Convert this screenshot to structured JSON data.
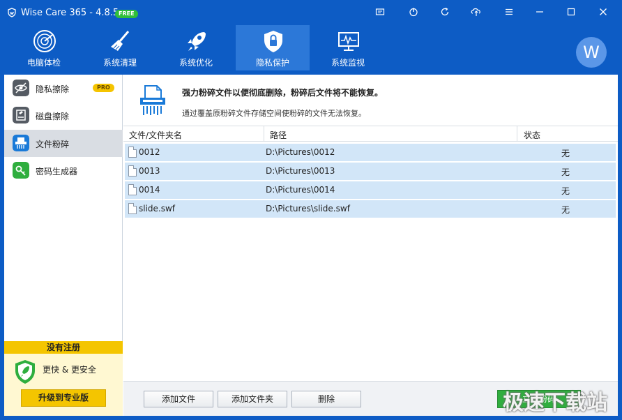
{
  "app": {
    "title": "Wise Care 365 - 4.8.5",
    "badge": "FREE",
    "accent_color": "#0d5cc5",
    "titlebar_icons": [
      "feedback-icon",
      "power-icon",
      "refresh-icon",
      "upload-icon",
      "menu-icon",
      "minimize-icon",
      "maximize-icon",
      "close-icon"
    ]
  },
  "tabs": [
    {
      "label": "电脑体检",
      "icon": "radar-icon"
    },
    {
      "label": "系统清理",
      "icon": "broom-icon"
    },
    {
      "label": "系统优化",
      "icon": "rocket-icon"
    },
    {
      "label": "隐私保护",
      "icon": "shield-lock-icon",
      "active": true
    },
    {
      "label": "系统监视",
      "icon": "monitor-icon"
    }
  ],
  "user": {
    "avatar_letter": "W"
  },
  "sidebar": {
    "items": [
      {
        "label": "隐私擦除",
        "badge": "PRO",
        "icon": "eye-slash-icon"
      },
      {
        "label": "磁盘擦除",
        "icon": "disk-eraser-icon"
      },
      {
        "label": "文件粉碎",
        "icon": "shredder-icon",
        "active": true
      },
      {
        "label": "密码生成器",
        "icon": "key-icon"
      }
    ]
  },
  "register": {
    "header": "没有注册",
    "tagline": "更快 & 更安全",
    "upgrade_label": "升级到专业版"
  },
  "main": {
    "title": "强力粉碎文件以便彻底删除，粉碎后文件将不能恢复。",
    "subtitle": "通过覆盖原粉碎文件存储空间使粉碎的文件无法恢复。",
    "columns": [
      "文件/文件夹名",
      "路径",
      "状态"
    ],
    "rows": [
      {
        "name": "0012",
        "path": "D:\\Pictures\\0012",
        "status": "无"
      },
      {
        "name": "0013",
        "path": "D:\\Pictures\\0013",
        "status": "无"
      },
      {
        "name": "0014",
        "path": "D:\\Pictures\\0014",
        "status": "无"
      },
      {
        "name": "slide.swf",
        "path": "D:\\Pictures\\slide.swf",
        "status": "无"
      }
    ]
  },
  "actions": {
    "add_file": "添加文件",
    "add_folder": "添加文件夹",
    "delete": "删除",
    "shred": "立即粉碎",
    "watermark": "极速下载站"
  }
}
